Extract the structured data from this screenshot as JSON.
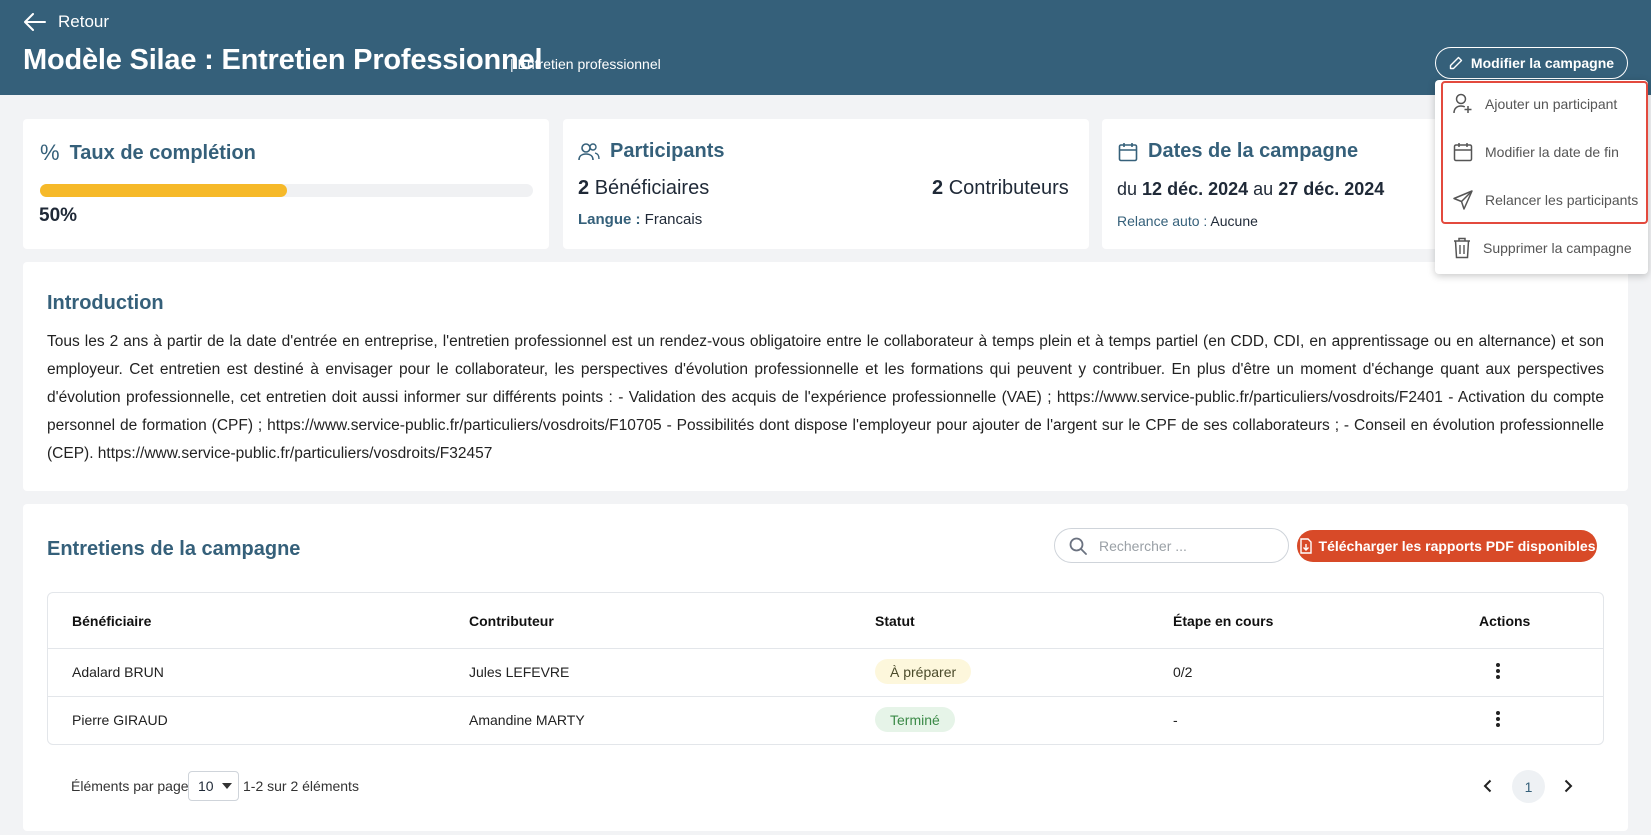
{
  "header": {
    "back_label": "Retour",
    "title": "Modèle Silae : Entretien Professionnel",
    "subtitle": "| Entretien professionnel",
    "edit_button": "Modifier la campagne"
  },
  "menu": {
    "items": [
      {
        "label": "Ajouter un participant",
        "icon": "user-plus-icon"
      },
      {
        "label": "Modifier la date de fin",
        "icon": "calendar-icon"
      },
      {
        "label": "Relancer les participants",
        "icon": "send-icon"
      },
      {
        "label": "Supprimer la campagne",
        "icon": "trash-icon"
      }
    ]
  },
  "completion": {
    "title": "Taux de complétion",
    "percent_label": "50%",
    "progress": 0.5
  },
  "participants": {
    "title": "Participants",
    "beneficiaries_count": "2",
    "beneficiaries_label": "Bénéficiaires",
    "contributors_count": "2",
    "contributors_label": "Contributeurs",
    "language_label": "Langue :",
    "language_value": "Francais"
  },
  "dates": {
    "title": "Dates de la campagne",
    "from_word": "du",
    "start": "12 déc. 2024",
    "to_word": "au",
    "end": "27 déc. 2024",
    "reminder_label": "Relance auto :",
    "reminder_value": "Aucune"
  },
  "intro": {
    "title": "Introduction",
    "text": "Tous les 2 ans à partir de la date d'entrée en entreprise, l'entretien professionnel est un rendez-vous obligatoire entre le collaborateur à temps plein et à temps partiel (en CDD, CDI, en apprentissage ou en alternance) et son employeur. Cet entretien est destiné à envisager pour le collaborateur, les perspectives d'évolution professionnelle et les formations qui peuvent y contribuer. En plus d'être un moment d'échange quant aux perspectives d'évolution professionnelle, cet entretien doit aussi informer sur différents points : - Validation des acquis de l'expérience professionnelle (VAE) ; https://www.service-public.fr/particuliers/vosdroits/F2401 - Activation du compte personnel de formation (CPF) ; https://www.service-public.fr/particuliers/vosdroits/F10705 - Possibilités dont dispose l'employeur pour ajouter de l'argent sur le CPF de ses collaborateurs ; - Conseil en évolution professionnelle (CEP). https://www.service-public.fr/particuliers/vosdroits/F32457"
  },
  "interviews": {
    "title": "Entretiens de la campagne",
    "search_placeholder": "Rechercher ...",
    "download_button": "Télécharger les rapports PDF disponibles",
    "columns": [
      "Bénéficiaire",
      "Contributeur",
      "Statut",
      "Étape en cours",
      "Actions"
    ],
    "rows": [
      {
        "beneficiary": "Adalard BRUN",
        "contributor": "Jules LEFEVRE",
        "status": "À préparer",
        "step": "0/2"
      },
      {
        "beneficiary": "Pierre GIRAUD",
        "contributor": "Amandine MARTY",
        "status": "Terminé",
        "step": "-"
      }
    ]
  },
  "pagination": {
    "per_page_label": "Éléments par page",
    "per_page_value": "10",
    "range_label": "1-2 sur 2 éléments",
    "current_page": "1"
  },
  "colors": {
    "header_bg": "#35607a",
    "progress": "#f6b929",
    "download": "#d84a28",
    "badge_pending_bg": "#fdf7dc",
    "badge_done_bg": "#e6f4e8",
    "badge_done_text": "#3b8a47",
    "menu_highlight": "#e34a3e"
  }
}
